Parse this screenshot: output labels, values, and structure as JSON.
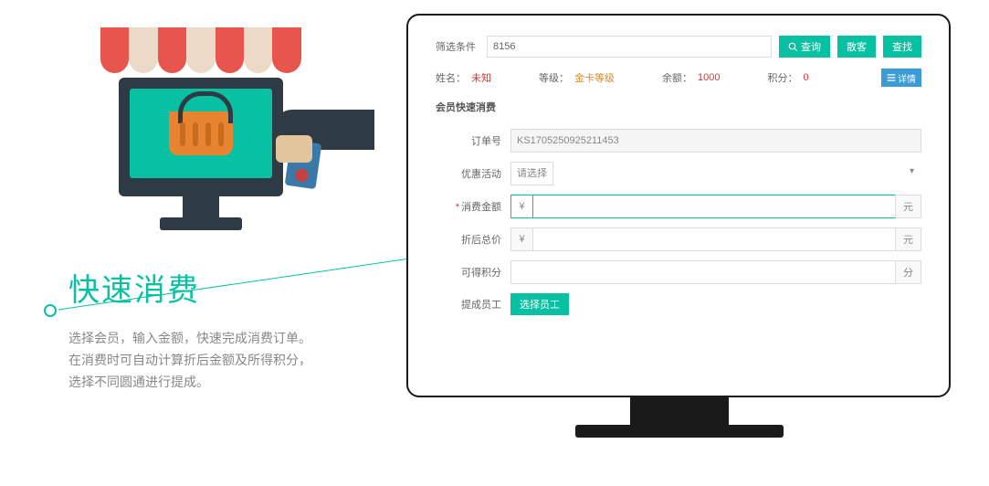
{
  "feature": {
    "title": "快速消费",
    "desc_line1": "选择会员，输入金额，快速完成消费订单。",
    "desc_line2": "在消费时可自动计算折后金额及所得积分，",
    "desc_line3": "选择不同圆通进行提成。"
  },
  "filter": {
    "label": "筛选条件",
    "value": "8156",
    "search_btn": "查询",
    "guest_btn": "散客",
    "find_btn": "查找"
  },
  "member": {
    "name_label": "姓名：",
    "name_value": "未知",
    "level_label": "等级：",
    "level_value": "金卡等级",
    "balance_label": "余额：",
    "balance_value": "1000",
    "points_label": "积分：",
    "points_value": "0",
    "detail_btn": "详情"
  },
  "section_title": "会员快速消费",
  "form": {
    "order_label": "订单号",
    "order_value": "KS1705250925211453",
    "promo_label": "优惠活动",
    "promo_placeholder": "请选择",
    "amount_label": "消费金额",
    "amount_prefix": "¥",
    "amount_suffix": "元",
    "discounted_label": "折后总价",
    "discounted_prefix": "¥",
    "discounted_suffix": "元",
    "points_label": "可得积分",
    "points_suffix": "分",
    "staff_label": "提成员工",
    "staff_btn": "选择员工"
  }
}
